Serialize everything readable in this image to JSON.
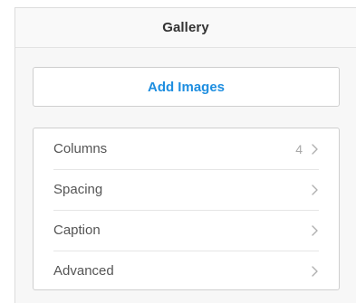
{
  "header": {
    "title": "Gallery"
  },
  "actions": {
    "add_images_label": "Add Images"
  },
  "settings": {
    "items": [
      {
        "label": "Columns",
        "value": "4"
      },
      {
        "label": "Spacing",
        "value": ""
      },
      {
        "label": "Caption",
        "value": ""
      },
      {
        "label": "Advanced",
        "value": ""
      }
    ]
  },
  "colors": {
    "accent": "#1e8ee0",
    "text": "#555555",
    "muted": "#a8a8a8"
  },
  "icons": {
    "row_indicator": "chevron-right-icon"
  }
}
